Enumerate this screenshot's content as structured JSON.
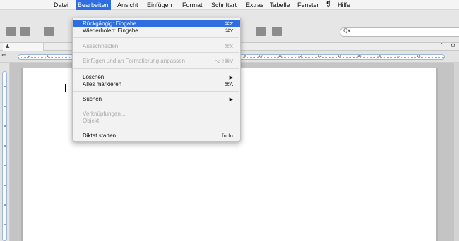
{
  "menubar": {
    "items": [
      {
        "label": "Datei"
      },
      {
        "label": "Bearbeiten"
      },
      {
        "label": "Ansicht"
      },
      {
        "label": "Einfügen"
      },
      {
        "label": "Format"
      },
      {
        "label": "Schriftart"
      },
      {
        "label": "Extras"
      },
      {
        "label": "Tabelle"
      },
      {
        "label": "Fenster"
      },
      {
        "label": "Hilfe"
      }
    ],
    "scripts_icon": "scripts-icon"
  },
  "edit_menu": {
    "items": [
      {
        "label": "Rückgängig: Eingabe",
        "shortcut": "⌘Z",
        "state": "selected"
      },
      {
        "label": "Wiederholen: Eingabe",
        "shortcut": "⌘Y",
        "state": "enabled"
      },
      {
        "label": "Ausschneiden",
        "shortcut": "⌘X",
        "state": "disabled"
      },
      {
        "label": "Einfügen und an Formatierung anpassen",
        "shortcut": "⌥⇧⌘V",
        "state": "disabled"
      },
      {
        "label": "Löschen",
        "shortcut": "▶",
        "state": "enabled"
      },
      {
        "label": "Alles markieren",
        "shortcut": "⌘A",
        "state": "enabled"
      },
      {
        "label": "Suchen",
        "shortcut": "▶",
        "state": "enabled"
      },
      {
        "label": "Verknüpfungen...",
        "shortcut": "",
        "state": "disabled"
      },
      {
        "label": "Objekt",
        "shortcut": "",
        "state": "disabled"
      },
      {
        "label": "Diktat starten ...",
        "shortcut": "fn fn",
        "state": "enabled"
      }
    ]
  },
  "search": {
    "icon": "search-icon",
    "glyph": "Q▾"
  },
  "ruler": {
    "numbers": [
      "2",
      "1",
      "8",
      "10",
      "11",
      "12",
      "13",
      "14",
      "15",
      "16",
      "17",
      "18"
    ]
  },
  "colors": {
    "highlight": "#2e6ee0",
    "menubar_bg": "#f4f4f4",
    "toolbar_bg": "#e6e6e6",
    "document_bg": "#c4c4c4"
  }
}
